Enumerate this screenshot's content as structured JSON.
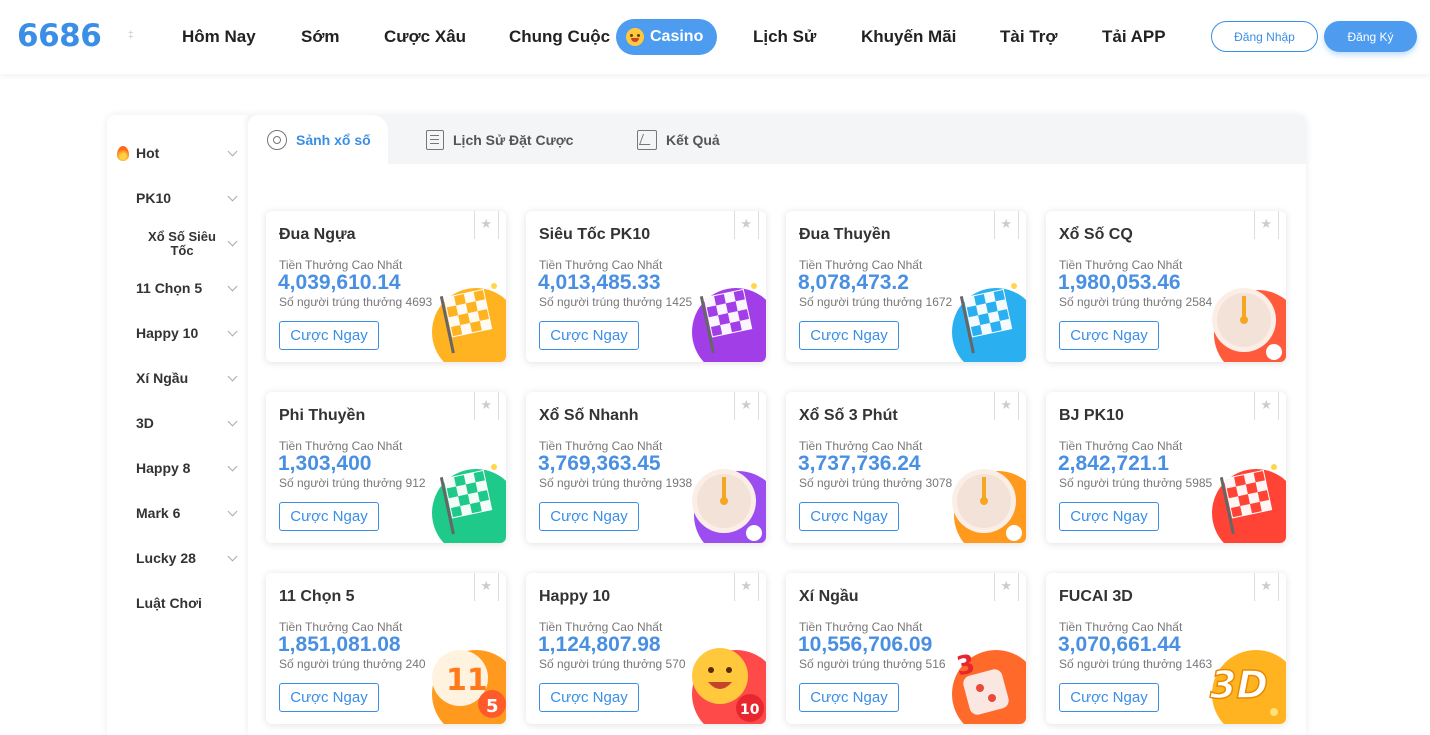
{
  "header": {
    "logo": "6686",
    "logo_mark": "‡",
    "nav": [
      "Hôm Nay",
      "Sớm",
      "Cược Xâu",
      "Chung Cuộc",
      "Casino",
      "Lịch Sử",
      "Khuyến Mãi",
      "Tài Trợ",
      "Tải APP"
    ],
    "login": "Đăng Nhập",
    "register": "Đăng Ký",
    "accent": "#4d9cf0"
  },
  "sidebar": {
    "items": [
      {
        "label": "Hot",
        "icon": "fire-icon"
      },
      {
        "label": "PK10"
      },
      {
        "label": "Xổ Số Siêu Tốc"
      },
      {
        "label": "11 Chọn 5"
      },
      {
        "label": "Happy 10"
      },
      {
        "label": "Xí Ngầu"
      },
      {
        "label": "3D"
      },
      {
        "label": "Happy 8"
      },
      {
        "label": "Mark 6"
      },
      {
        "label": "Lucky 28"
      },
      {
        "label": "Luật Chơi"
      }
    ]
  },
  "tabs": [
    {
      "label": "Sảnh xổ số",
      "icon": "disc-icon",
      "active": true
    },
    {
      "label": "Lịch Sử Đặt Cược",
      "icon": "document-icon",
      "active": false
    },
    {
      "label": "Kết Quả",
      "icon": "chart-icon",
      "active": false
    }
  ],
  "card_labels": {
    "prize_caption": "Tiền Thưởng Cao Nhất",
    "button": "Cược Ngay"
  },
  "games": [
    {
      "title": "Đua Ngựa",
      "prize": "4,039,610.14",
      "winners": "Số người trúng thưởng 4693",
      "art": "checkered-flag-horse",
      "color": "#ffb321"
    },
    {
      "title": "Siêu Tốc PK10",
      "prize": "4,013,485.33",
      "winners": "Số người trúng thưởng 1425",
      "art": "checkered-flag-racecar",
      "color": "#a23ee8"
    },
    {
      "title": "Đua Thuyền",
      "prize": "8,078,473.2",
      "winners": "Số người trúng thưởng 1672",
      "art": "checkered-flag-boat",
      "color": "#2ab0f0"
    },
    {
      "title": "Xổ Số CQ",
      "prize": "1,980,053.46",
      "winners": "Số người trúng thưởng 2584",
      "art": "clock-heart",
      "color": "#ff5a3c"
    },
    {
      "title": "Phi Thuyền",
      "prize": "1,303,400",
      "winners": "Số người trúng thưởng 912",
      "art": "checkered-flag-ship",
      "color": "#1ec98a"
    },
    {
      "title": "Xổ Số Nhanh",
      "prize": "3,769,363.45",
      "winners": "Số người trúng thưởng 1938",
      "art": "clock-purple",
      "color": "#9b4df0"
    },
    {
      "title": "Xổ Số 3 Phút",
      "prize": "3,737,736.24",
      "winners": "Số người trúng thưởng 3078",
      "art": "clock-orange",
      "color": "#ff9a1f"
    },
    {
      "title": "BJ PK10",
      "prize": "2,842,721.1",
      "winners": "Số người trúng thưởng 5985",
      "art": "checkered-flag-red",
      "color": "#ff4436"
    },
    {
      "title": "11 Chọn 5",
      "prize": "1,851,081.08",
      "winners": "Số người trúng thưởng 240",
      "art": "ball-11",
      "color": "#ff9a1f"
    },
    {
      "title": "Happy 10",
      "prize": "1,124,807.98",
      "winners": "Số người trúng thưởng 570",
      "art": "smiley-10",
      "color": "#ff4a4a"
    },
    {
      "title": "Xí Ngầu",
      "prize": "10,556,706.09",
      "winners": "Số người trúng thưởng 516",
      "art": "dice-3",
      "color": "#ff6a2a"
    },
    {
      "title": "FUCAI 3D",
      "prize": "3,070,661.44",
      "winners": "Số người trúng thưởng 1463",
      "art": "text-3d",
      "color": "#ffb321"
    }
  ]
}
